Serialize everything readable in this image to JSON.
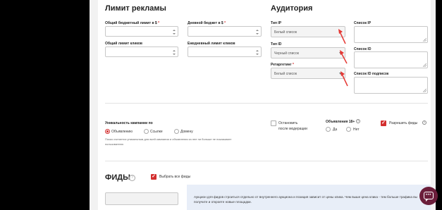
{
  "budget": {
    "title": "Лимит рекламы",
    "fields": [
      {
        "label": "Общий бюджетный лимит в $",
        "value": ""
      },
      {
        "label": "Дневной бюджет в $",
        "value": ""
      },
      {
        "label": "Общий лимит кликов",
        "value": ""
      },
      {
        "label": "Ежедневный лимит кликов",
        "value": ""
      }
    ]
  },
  "audience": {
    "title": "Аудитория",
    "ip_type": {
      "label": "Тип IP",
      "value": "Белый список"
    },
    "id_type": {
      "label": "Тип ID",
      "value": "Черный список"
    },
    "retargeting": {
      "label": "Ретаргетинг",
      "value": "Белый список"
    },
    "ip_list": {
      "label": "Список IP",
      "value": ""
    },
    "id_list": {
      "label": "Список ID",
      "value": ""
    },
    "id_subscription_list": {
      "label": "Список ID подписок",
      "value": ""
    }
  },
  "uniqueness": {
    "label": "Уникальность кампании по",
    "options": [
      "Объявлению",
      "Ссылке",
      "Домену"
    ],
    "selected": "Объявлению",
    "hint_line1": "Показ считается уникальным для всей кампании и объявления из нее ни больше не показывает",
    "hint_line2": "пользователю"
  },
  "stop_after_moderation": {
    "line1": "Остановить",
    "line2": "после модерации",
    "checked": false
  },
  "ads18": {
    "label": "Объявления 18+",
    "help": "?",
    "options": [
      "Да",
      "Нет"
    ],
    "selected": null
  },
  "allow_feeds": {
    "label": "Разрешить фиды",
    "help": "?",
    "checked": true
  },
  "feeds": {
    "title": "ФИДЫ",
    "help": "?",
    "select_all_label": "Выбрать все фиды",
    "select_all_checked": true,
    "search_value": ""
  },
  "info": {
    "text": "Аукцион для фидов строиться отдельно от внутреннего аукциона и позиция зависит от цены клика. Чем выше цена клика - тем больше трафика вы получите и откроете новые площадки."
  },
  "colors": {
    "accent": "#d32f2f",
    "chat": "#6b1e3a",
    "info_bg": "#e8eef8"
  },
  "icons": {
    "chat": "chat-bubble-icon",
    "check": "✓"
  }
}
